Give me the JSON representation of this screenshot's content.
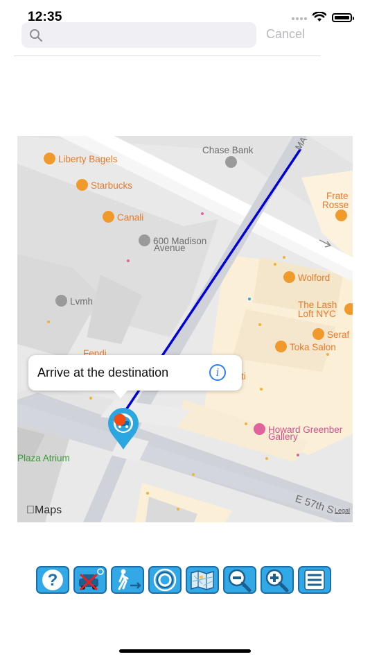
{
  "status": {
    "time": "12:35"
  },
  "search": {
    "placeholder": "",
    "cancel_label": "Cancel"
  },
  "map": {
    "pois": {
      "liberty_bagels": "Liberty Bagels",
      "starbucks": "Starbucks",
      "canali": "Canali",
      "chase_bank": "Chase Bank",
      "madison_600_line1": "600 Madison",
      "madison_600_line2": "Avenue",
      "lvmh": "Lvmh",
      "fendi": "Fendi",
      "frate_line1": "Frate",
      "frate_line2": "Rosse",
      "wolford": "Wolford",
      "the_lash_line1": "The Lash",
      "the_lash_line2": "Loft NYC",
      "seraf": "Seraf",
      "toka_salon": "Toka Salon",
      "fragment_ti": "ti",
      "howard_line1": "Howard Greenber",
      "howard_line2": "Gallery",
      "plaza_atrium": "Plaza Atrium",
      "street_57": "E 57th S",
      "street_ma": "MA"
    },
    "logo_label": "Maps",
    "legal_label": "Legal",
    "callout": {
      "text": "Arrive at the destination",
      "info_glyph": "i"
    },
    "colors": {
      "route": "#0000d8",
      "destination_pin": "#2ca6e0",
      "poi_orange": "#e8792a"
    }
  },
  "toolbar": {
    "buttons": [
      {
        "name": "help",
        "icon": "question-icon"
      },
      {
        "name": "no-parking",
        "icon": "car-cross-icon"
      },
      {
        "name": "walk-route",
        "icon": "walking-person-icon"
      },
      {
        "name": "locate",
        "icon": "target-rings-icon"
      },
      {
        "name": "map-view",
        "icon": "folded-map-icon"
      },
      {
        "name": "zoom-out",
        "icon": "magnifier-minus-icon"
      },
      {
        "name": "zoom-in",
        "icon": "magnifier-plus-icon"
      },
      {
        "name": "menu",
        "icon": "list-icon"
      }
    ],
    "help_glyph": "?"
  }
}
